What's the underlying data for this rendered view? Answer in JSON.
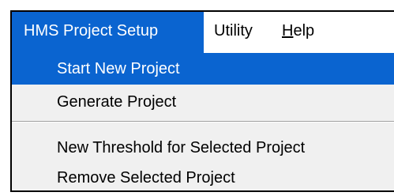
{
  "menubar": {
    "items": [
      {
        "label": "HMS Project Setup",
        "active": true
      },
      {
        "label": "Utility",
        "active": false
      },
      {
        "label_prefix": "",
        "label_accel": "H",
        "label_rest": "elp",
        "active": false
      }
    ]
  },
  "dropdown": {
    "items": [
      {
        "label": "Start New Project",
        "highlighted": true
      },
      {
        "label": "Generate Project",
        "highlighted": false
      },
      {
        "label": "New Threshold for Selected Project",
        "highlighted": false
      },
      {
        "label": "Remove Selected Project",
        "highlighted": false
      }
    ]
  },
  "colors": {
    "highlight": "#0a64d0",
    "menu_background": "#f0f0f0",
    "menubar_background": "#ffffff"
  }
}
